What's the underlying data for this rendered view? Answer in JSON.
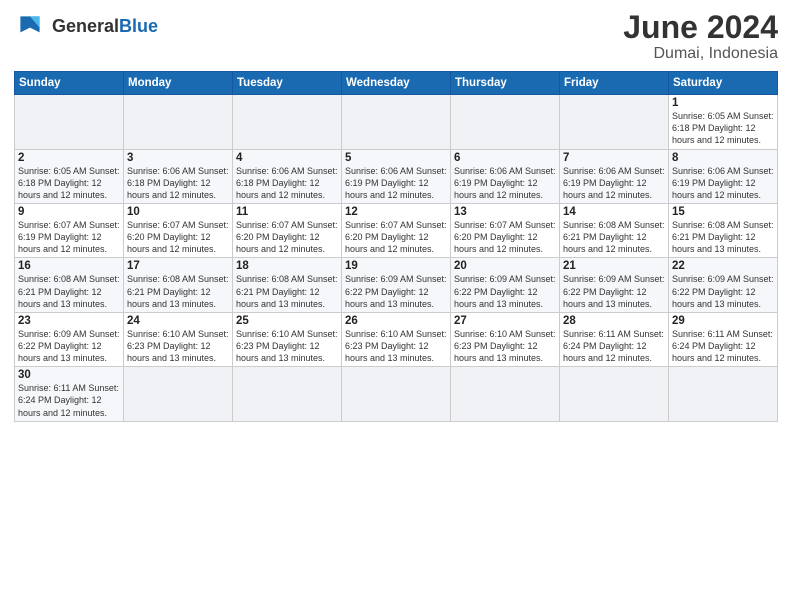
{
  "header": {
    "logo_general": "General",
    "logo_blue": "Blue",
    "month_year": "June 2024",
    "location": "Dumai, Indonesia"
  },
  "weekdays": [
    "Sunday",
    "Monday",
    "Tuesday",
    "Wednesday",
    "Thursday",
    "Friday",
    "Saturday"
  ],
  "weeks": [
    {
      "days": [
        {
          "num": "",
          "info": "",
          "empty": true
        },
        {
          "num": "",
          "info": "",
          "empty": true
        },
        {
          "num": "",
          "info": "",
          "empty": true
        },
        {
          "num": "",
          "info": "",
          "empty": true
        },
        {
          "num": "",
          "info": "",
          "empty": true
        },
        {
          "num": "",
          "info": "",
          "empty": true
        },
        {
          "num": "1",
          "info": "Sunrise: 6:05 AM\nSunset: 6:18 PM\nDaylight: 12 hours\nand 12 minutes.",
          "empty": false
        }
      ]
    },
    {
      "days": [
        {
          "num": "2",
          "info": "Sunrise: 6:05 AM\nSunset: 6:18 PM\nDaylight: 12 hours\nand 12 minutes.",
          "empty": false
        },
        {
          "num": "3",
          "info": "Sunrise: 6:06 AM\nSunset: 6:18 PM\nDaylight: 12 hours\nand 12 minutes.",
          "empty": false
        },
        {
          "num": "4",
          "info": "Sunrise: 6:06 AM\nSunset: 6:18 PM\nDaylight: 12 hours\nand 12 minutes.",
          "empty": false
        },
        {
          "num": "5",
          "info": "Sunrise: 6:06 AM\nSunset: 6:19 PM\nDaylight: 12 hours\nand 12 minutes.",
          "empty": false
        },
        {
          "num": "6",
          "info": "Sunrise: 6:06 AM\nSunset: 6:19 PM\nDaylight: 12 hours\nand 12 minutes.",
          "empty": false
        },
        {
          "num": "7",
          "info": "Sunrise: 6:06 AM\nSunset: 6:19 PM\nDaylight: 12 hours\nand 12 minutes.",
          "empty": false
        },
        {
          "num": "8",
          "info": "Sunrise: 6:06 AM\nSunset: 6:19 PM\nDaylight: 12 hours\nand 12 minutes.",
          "empty": false
        }
      ]
    },
    {
      "days": [
        {
          "num": "9",
          "info": "Sunrise: 6:07 AM\nSunset: 6:19 PM\nDaylight: 12 hours\nand 12 minutes.",
          "empty": false
        },
        {
          "num": "10",
          "info": "Sunrise: 6:07 AM\nSunset: 6:20 PM\nDaylight: 12 hours\nand 12 minutes.",
          "empty": false
        },
        {
          "num": "11",
          "info": "Sunrise: 6:07 AM\nSunset: 6:20 PM\nDaylight: 12 hours\nand 12 minutes.",
          "empty": false
        },
        {
          "num": "12",
          "info": "Sunrise: 6:07 AM\nSunset: 6:20 PM\nDaylight: 12 hours\nand 12 minutes.",
          "empty": false
        },
        {
          "num": "13",
          "info": "Sunrise: 6:07 AM\nSunset: 6:20 PM\nDaylight: 12 hours\nand 12 minutes.",
          "empty": false
        },
        {
          "num": "14",
          "info": "Sunrise: 6:08 AM\nSunset: 6:21 PM\nDaylight: 12 hours\nand 12 minutes.",
          "empty": false
        },
        {
          "num": "15",
          "info": "Sunrise: 6:08 AM\nSunset: 6:21 PM\nDaylight: 12 hours\nand 13 minutes.",
          "empty": false
        }
      ]
    },
    {
      "days": [
        {
          "num": "16",
          "info": "Sunrise: 6:08 AM\nSunset: 6:21 PM\nDaylight: 12 hours\nand 13 minutes.",
          "empty": false
        },
        {
          "num": "17",
          "info": "Sunrise: 6:08 AM\nSunset: 6:21 PM\nDaylight: 12 hours\nand 13 minutes.",
          "empty": false
        },
        {
          "num": "18",
          "info": "Sunrise: 6:08 AM\nSunset: 6:21 PM\nDaylight: 12 hours\nand 13 minutes.",
          "empty": false
        },
        {
          "num": "19",
          "info": "Sunrise: 6:09 AM\nSunset: 6:22 PM\nDaylight: 12 hours\nand 13 minutes.",
          "empty": false
        },
        {
          "num": "20",
          "info": "Sunrise: 6:09 AM\nSunset: 6:22 PM\nDaylight: 12 hours\nand 13 minutes.",
          "empty": false
        },
        {
          "num": "21",
          "info": "Sunrise: 6:09 AM\nSunset: 6:22 PM\nDaylight: 12 hours\nand 13 minutes.",
          "empty": false
        },
        {
          "num": "22",
          "info": "Sunrise: 6:09 AM\nSunset: 6:22 PM\nDaylight: 12 hours\nand 13 minutes.",
          "empty": false
        }
      ]
    },
    {
      "days": [
        {
          "num": "23",
          "info": "Sunrise: 6:09 AM\nSunset: 6:22 PM\nDaylight: 12 hours\nand 13 minutes.",
          "empty": false
        },
        {
          "num": "24",
          "info": "Sunrise: 6:10 AM\nSunset: 6:23 PM\nDaylight: 12 hours\nand 13 minutes.",
          "empty": false
        },
        {
          "num": "25",
          "info": "Sunrise: 6:10 AM\nSunset: 6:23 PM\nDaylight: 12 hours\nand 13 minutes.",
          "empty": false
        },
        {
          "num": "26",
          "info": "Sunrise: 6:10 AM\nSunset: 6:23 PM\nDaylight: 12 hours\nand 13 minutes.",
          "empty": false
        },
        {
          "num": "27",
          "info": "Sunrise: 6:10 AM\nSunset: 6:23 PM\nDaylight: 12 hours\nand 13 minutes.",
          "empty": false
        },
        {
          "num": "28",
          "info": "Sunrise: 6:11 AM\nSunset: 6:24 PM\nDaylight: 12 hours\nand 12 minutes.",
          "empty": false
        },
        {
          "num": "29",
          "info": "Sunrise: 6:11 AM\nSunset: 6:24 PM\nDaylight: 12 hours\nand 12 minutes.",
          "empty": false
        }
      ]
    },
    {
      "days": [
        {
          "num": "30",
          "info": "Sunrise: 6:11 AM\nSunset: 6:24 PM\nDaylight: 12 hours\nand 12 minutes.",
          "empty": false
        },
        {
          "num": "",
          "info": "",
          "empty": true
        },
        {
          "num": "",
          "info": "",
          "empty": true
        },
        {
          "num": "",
          "info": "",
          "empty": true
        },
        {
          "num": "",
          "info": "",
          "empty": true
        },
        {
          "num": "",
          "info": "",
          "empty": true
        },
        {
          "num": "",
          "info": "",
          "empty": true
        }
      ]
    }
  ]
}
